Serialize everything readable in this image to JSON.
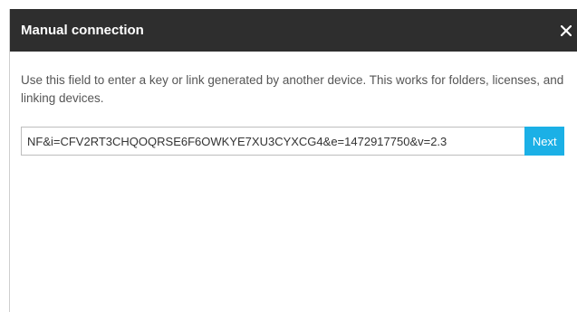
{
  "dialog": {
    "title": "Manual connection",
    "close_icon": "close-icon",
    "description": "Use this field to enter a key or link generated by another device. This works for folders, licenses, and linking devices.",
    "key_input": {
      "value": "NF&i=CFV2RT3CHQOQRSE6F6OWKYE7XU3CYXCG4&e=1472917750&v=2.3",
      "placeholder": ""
    },
    "next_label": "Next"
  },
  "colors": {
    "titlebar": "#2e2e2e",
    "accent": "#1bb0e6"
  }
}
